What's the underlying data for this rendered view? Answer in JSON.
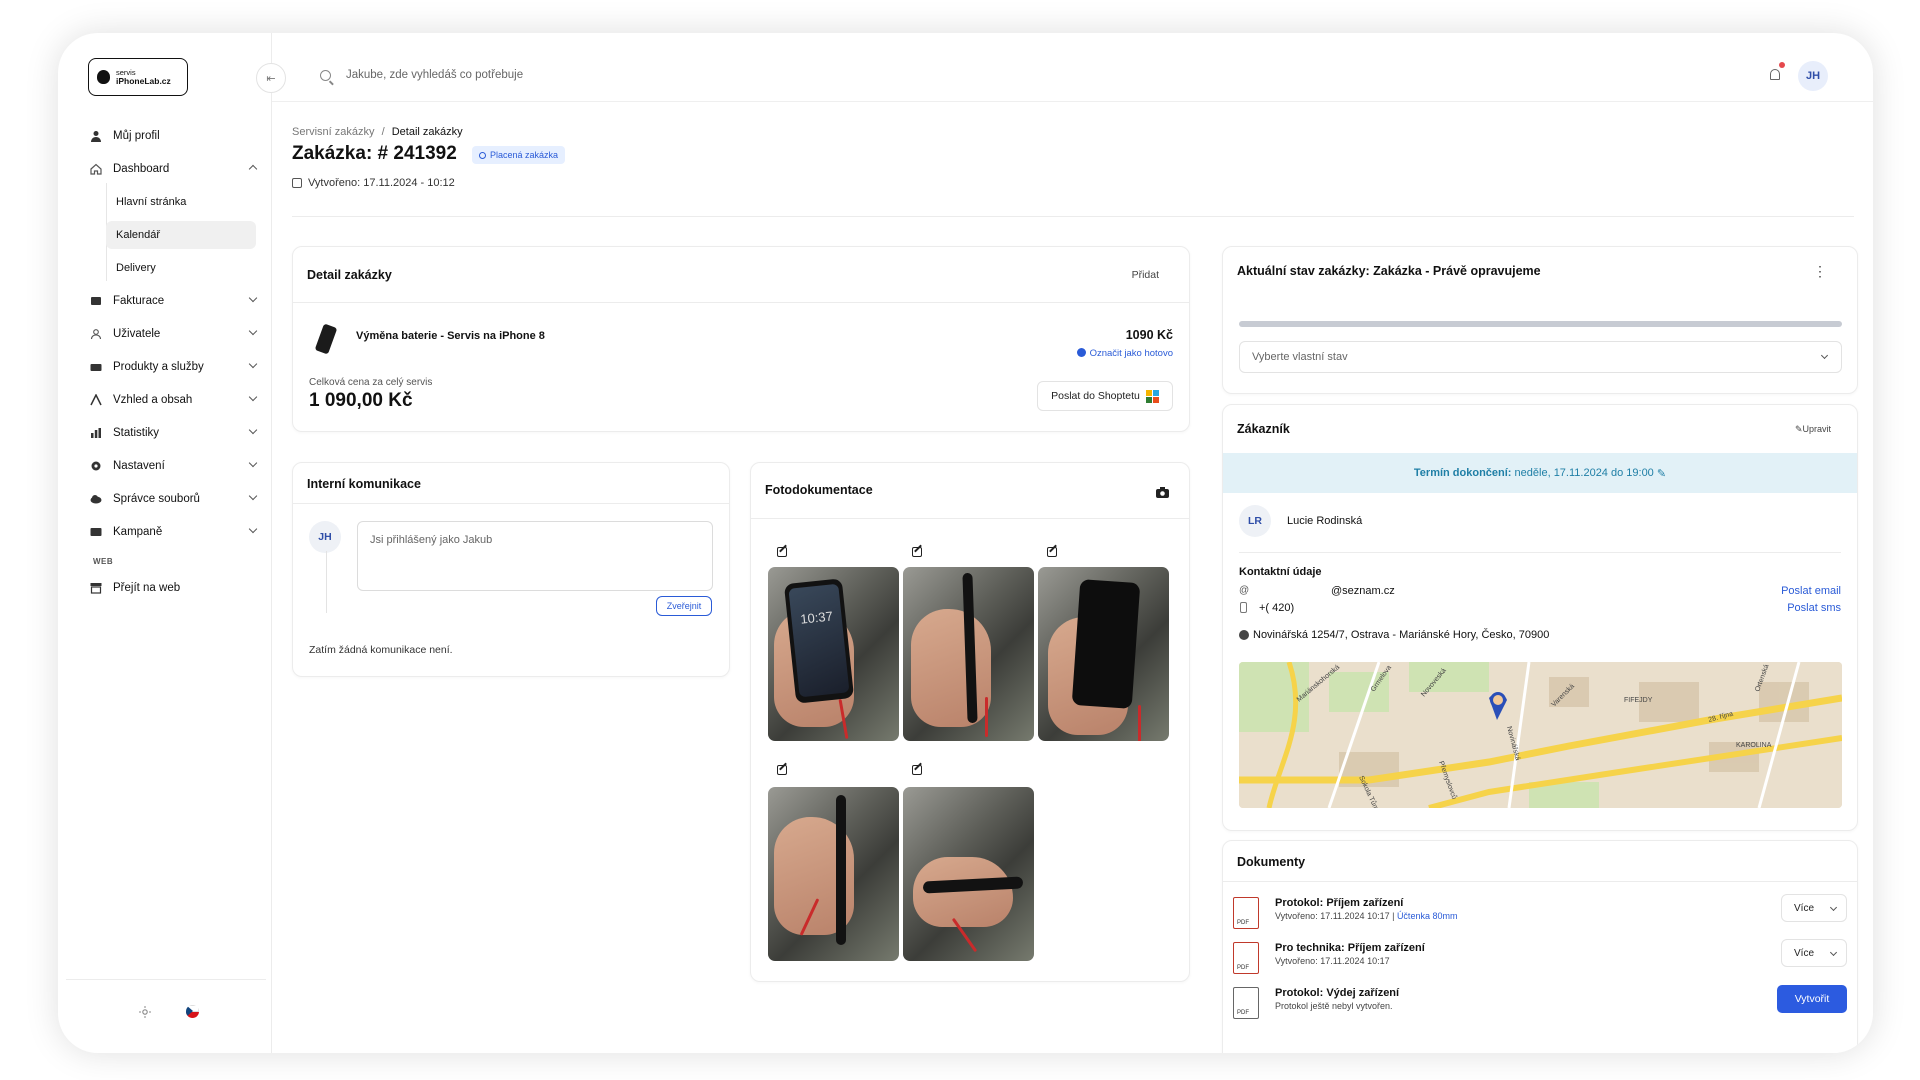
{
  "brand": {
    "line1": "servis",
    "line2": "iPhoneLab.cz"
  },
  "search": {
    "placeholder": "Jakube, zde vyhledáš co potřebuje"
  },
  "user": {
    "initials": "JH"
  },
  "sidebar": {
    "items": [
      {
        "label": "Můj profil",
        "icon": "user-icon"
      },
      {
        "label": "Dashboard",
        "icon": "home-icon"
      },
      {
        "label": "Fakturace",
        "icon": "invoice-icon"
      },
      {
        "label": "Uživatele",
        "icon": "users-icon"
      },
      {
        "label": "Produkty a služby",
        "icon": "box-icon"
      },
      {
        "label": "Vzhled a obsah",
        "icon": "brush-icon"
      },
      {
        "label": "Statistiky",
        "icon": "chart-icon"
      },
      {
        "label": "Nastavení",
        "icon": "gear-icon"
      },
      {
        "label": "Správce souborů",
        "icon": "cloud-icon"
      },
      {
        "label": "Kampaně",
        "icon": "campaign-icon"
      }
    ],
    "sub_items": [
      "Hlavní stránka",
      "Kalendář",
      "Delivery"
    ],
    "section": "WEB",
    "web_item": "Přejít na web"
  },
  "header": {
    "breadcrumb_parent": "Servisní zakázky",
    "breadcrumb_sep": "/",
    "breadcrumb_current": "Detail zakázky",
    "title": "Zakázka: # 241392",
    "badge": "Placená zakázka",
    "created": "Vytvořeno: 17.11.2024 - 10:12"
  },
  "detail": {
    "title": "Detail zakázky",
    "add": "Přidat",
    "service": "Výměna baterie - Servis na iPhone 8",
    "price": "1090 Kč",
    "mark_done": "Označit jako hotovo",
    "total_label": "Celková cena za celý servis",
    "total": "1 090,00 Kč",
    "send_shoptet": "Poslat do Shoptetu"
  },
  "internal": {
    "title": "Interní komunikace",
    "placeholder": "Jsi přihlášený jako Jakub",
    "publish": "Zveřejnit",
    "empty": "Zatím žádná komunikace není."
  },
  "photos": {
    "title": "Fotodokumentace",
    "lock_time": "10:37"
  },
  "status": {
    "title": "Aktuální stav zakázky: Zakázka - Právě opravujeme",
    "select_placeholder": "Vyberte vlastní stav",
    "progress": 1.0
  },
  "customer": {
    "title": "Zákazník",
    "edit": "Upravit",
    "termin_label": "Termín dokončení:",
    "termin_value": "neděle, 17.11.2024 do 19:00",
    "initials": "LR",
    "name": "Lucie Rodinská",
    "contacts_title": "Kontaktní údaje",
    "email_prefix": "@",
    "email": "@seznam.cz",
    "phone": "+( 420)",
    "send_email": "Poslat email",
    "send_sms": "Poslat sms",
    "address": "Novinářská 1254/7, Ostrava - Mariánské Hory, Česko, 70900"
  },
  "map": {
    "labels": [
      "Mariánskohorská",
      "Grmelova",
      "Novoveská",
      "Přemyslovců",
      "Varenská",
      "28. října",
      "KAROLINA",
      "FIFEJDY",
      "Sokola Tůmy",
      "Novinářská",
      "Ortenská"
    ]
  },
  "documents": {
    "title": "Dokumenty",
    "items": [
      {
        "title": "Protokol: Příjem zařízení",
        "sub": "Vytvořeno: 17.11.2024 10:17",
        "link": "Účtenka 80mm",
        "action": "Více"
      },
      {
        "title": "Pro technika: Příjem zařízení",
        "sub": "Vytvořeno: 17.11.2024 10:17",
        "action": "Více"
      },
      {
        "title": "Protokol: Výdej zařízení",
        "sub": "Protokol ještě nebyl vytvořen.",
        "action": "Vytvořit"
      }
    ]
  },
  "colors": {
    "accent": "#2c5be0",
    "badge_bg": "#e6efff",
    "termin_bg": "#e2f1f7"
  }
}
